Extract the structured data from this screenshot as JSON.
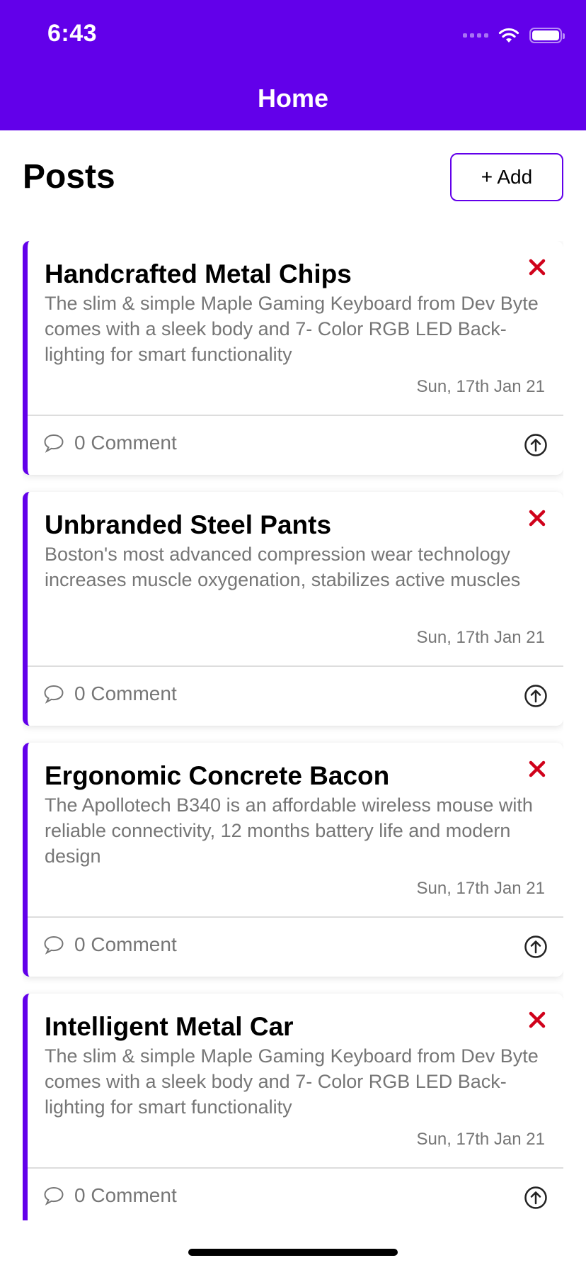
{
  "status_bar": {
    "time": "6:43"
  },
  "navigation": {
    "title": "Home"
  },
  "main": {
    "title": "Posts",
    "add_label": "+ Add"
  },
  "posts": [
    {
      "title": "Handcrafted Metal Chips",
      "body": "The slim & simple Maple Gaming Keyboard from Dev Byte comes with a sleek body and 7- Color RGB LED Back-lighting for smart functionality",
      "date": "Sun, 17th Jan 21",
      "comments": "0 Comment"
    },
    {
      "title": "Unbranded Steel Pants",
      "body": "Boston's most advanced compression wear technology increases muscle oxygenation, stabilizes active muscles",
      "date": "Sun, 17th Jan 21",
      "comments": "0 Comment"
    },
    {
      "title": "Ergonomic Concrete Bacon",
      "body": "The Apollotech B340 is an affordable wireless mouse with reliable connectivity, 12 months battery life and modern design",
      "date": "Sun, 17th Jan 21",
      "comments": "0 Comment"
    },
    {
      "title": "Intelligent Metal Car",
      "body": "The slim & simple Maple Gaming Keyboard from Dev Byte comes with a sleek body and 7- Color RGB LED Back-lighting for smart functionality",
      "date": "Sun, 17th Jan 21",
      "comments": "0 Comment"
    }
  ],
  "theme": {
    "accent": "#6200ea",
    "delete": "#d0021b",
    "muted_text": "#767676"
  },
  "icons": {
    "delete": "close-icon",
    "comment": "speech-bubble-icon",
    "share": "arrow-up-circle-icon",
    "wifi": "wifi-icon",
    "battery": "battery-icon",
    "signal": "cellular-signal-icon"
  }
}
